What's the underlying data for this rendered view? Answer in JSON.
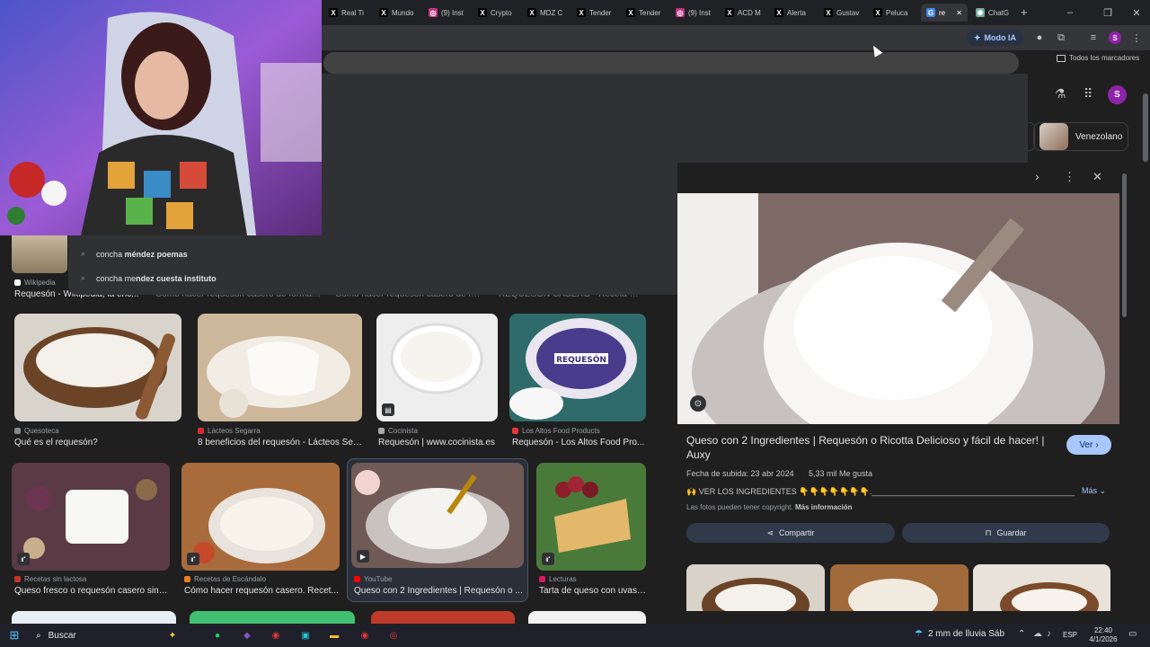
{
  "tabs": [
    {
      "label": "Real Ti",
      "icon": "x-icon"
    },
    {
      "label": "Mundo",
      "icon": "x-icon"
    },
    {
      "label": "(9) Inst",
      "icon": "instagram-icon"
    },
    {
      "label": "Crypto",
      "icon": "x-icon"
    },
    {
      "label": "MDZ C",
      "icon": "x-icon"
    },
    {
      "label": "Tender",
      "icon": "x-icon"
    },
    {
      "label": "Tender",
      "icon": "x-icon"
    },
    {
      "label": "(9) Inst",
      "icon": "instagram-icon"
    },
    {
      "label": "ACD M",
      "icon": "x-icon"
    },
    {
      "label": "Alerta",
      "icon": "x-icon"
    },
    {
      "label": "Gustav",
      "icon": "x-icon"
    },
    {
      "label": "Peluca",
      "icon": "x-icon"
    },
    {
      "label": "re",
      "icon": "google-icon"
    },
    {
      "label": "ChatG",
      "icon": "chatgpt-icon"
    }
  ],
  "toolbar": {
    "modo_ia": "Modo IA",
    "bookmarks": "Todos los marcadores"
  },
  "suggestions": [
    {
      "prefix": "concha ",
      "bold": "méndez poemas"
    },
    {
      "prefix": "concha me",
      "bold": "ndez cuesta instituto"
    }
  ],
  "chip": {
    "label": "Venezolano"
  },
  "account_initial": "S",
  "row0": [
    {
      "source": "Wikipedia",
      "title": "Requesón - Wikipedia, la enc..."
    },
    {
      "source": "",
      "title": "Cómo hacer requesón casero de forma f..."
    },
    {
      "source": "",
      "title": "Cómo hacer requesón casero de fo..."
    },
    {
      "source": "",
      "title": "REQUESÓN CASERO - Receta Pa..."
    }
  ],
  "row1": [
    {
      "source": "Quesoteca",
      "title": "Qué es el requesón?"
    },
    {
      "source": "Lácteos Segarra",
      "title": "8 beneficios del requesón - Lácteos Seg..."
    },
    {
      "source": "Cocinista",
      "title": "Requesón | www.cocinista.es"
    },
    {
      "source": "Los Altos Food Products",
      "title": "Requesón - Los Altos Food Pro..."
    }
  ],
  "row2": [
    {
      "source": "Recetas sin lactosa",
      "title": "Queso fresco o requesón casero sin l..."
    },
    {
      "source": "Recetas de Escándalo",
      "title": "Cómo hacer requesón casero. Recet..."
    },
    {
      "source": "YouTube",
      "title": "Queso con 2 Ingredientes | Requesón o ..."
    },
    {
      "source": "Lecturas",
      "title": "Tarta de queso con uvas ..."
    }
  ],
  "requeson_label": "REQUESÓN",
  "panel": {
    "title": "Queso con 2 Ingredientes | Requesón o Ricotta Delicioso y fácil de hacer! | Auxy",
    "ver": "Ver",
    "date": "Fecha de subida: 23 abr 2024",
    "likes": "5,33 mil Me gusta",
    "desc": "VER LOS INGREDIENTES 👇👇👇👇👇👇👇.________________________________________________",
    "mas": "Más",
    "copyright": "Las fotos pueden tener copyright.",
    "mas_info": "Más información",
    "share": "Compartir",
    "save": "Guardar"
  },
  "taskbar": {
    "search": "Buscar",
    "weather": "2 mm de lluvia Sáb",
    "lang": "ESP",
    "time": "22:40",
    "date": "4/1/2026"
  }
}
